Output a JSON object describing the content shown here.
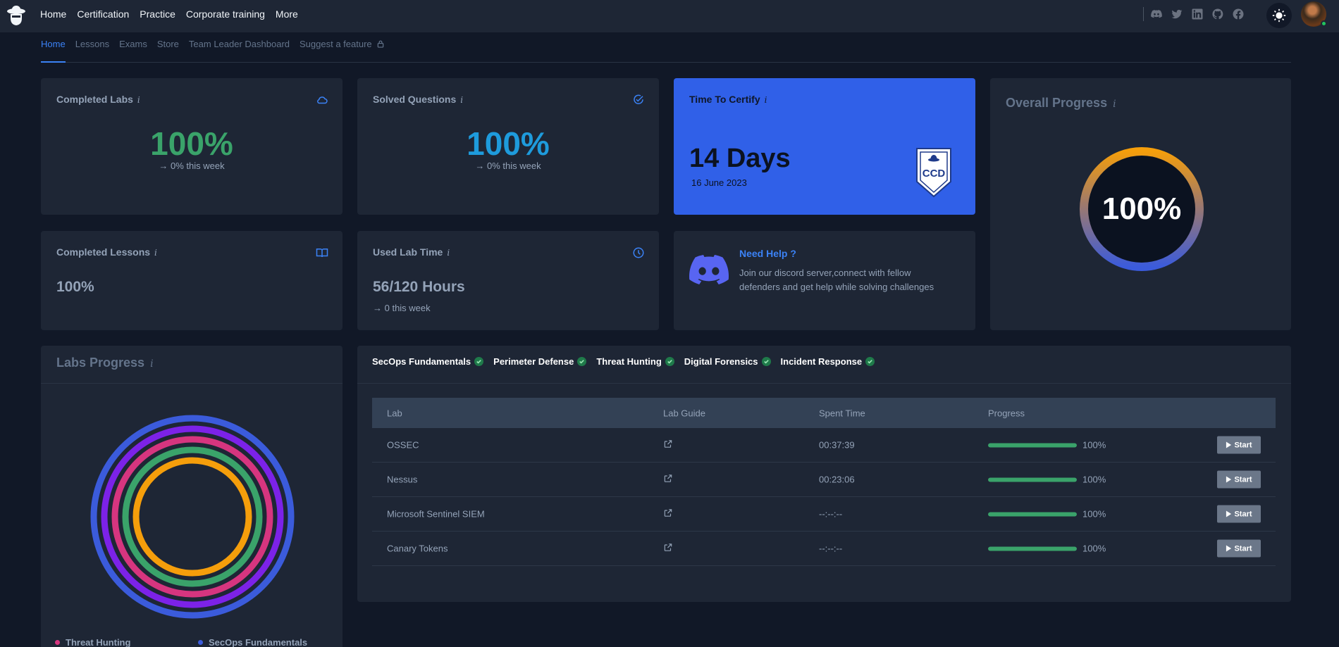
{
  "topnav": {
    "items": [
      "Home",
      "Certification",
      "Practice",
      "Corporate training",
      "More"
    ],
    "social_icons": [
      "discord-icon",
      "twitter-icon",
      "linkedin-icon",
      "github-icon",
      "facebook-icon"
    ]
  },
  "subtabs": [
    "Home",
    "Lessons",
    "Exams",
    "Store",
    "Team Leader Dashboard",
    "Suggest a feature"
  ],
  "cards": {
    "completed_labs": {
      "title": "Completed Labs",
      "value": "100%",
      "week": "→ 0% this week",
      "color": "#3aa36a"
    },
    "solved_questions": {
      "title": "Solved Questions",
      "value": "100%",
      "week": "→ 0% this week",
      "color": "#1e9bdc"
    },
    "time_to_certify": {
      "title": "Time To Certify",
      "days": "14 Days",
      "date": "16 June 2023",
      "badge_text": "CCD"
    },
    "overall_progress": {
      "title": "Overall Progress",
      "value": "100%",
      "progress": 1.0
    },
    "completed_lessons": {
      "title": "Completed Lessons",
      "value": "100%"
    },
    "used_lab_time": {
      "title": "Used Lab Time",
      "value": "56/120 Hours",
      "week": "→  0 this week"
    },
    "need_help": {
      "title": "Need Help ?",
      "text": "Join our discord server,connect with fellow defenders and get help while solving challenges"
    }
  },
  "labs_progress": {
    "title": "Labs Progress",
    "rings": [
      {
        "name": "SecOps Fundamentals",
        "color": "#3b5bdb",
        "progress": 1.0
      },
      {
        "name": "Perimeter Defense",
        "color": "#7c22e8",
        "progress": 1.0
      },
      {
        "name": "Threat Hunting",
        "color": "#d6357f",
        "progress": 1.0
      },
      {
        "name": "Digital Forensics",
        "color": "#3aa36a",
        "progress": 1.0
      },
      {
        "name": "Incident Response",
        "color": "#f59e0b",
        "progress": 1.0
      }
    ],
    "legend": [
      {
        "name": "Threat Hunting",
        "color": "#d6357f"
      },
      {
        "name": "SecOps Fundamentals",
        "color": "#3b5bdb"
      }
    ]
  },
  "lab_categories": [
    "SecOps Fundamentals",
    "Perimeter Defense",
    "Threat Hunting",
    "Digital Forensics",
    "Incident Response"
  ],
  "lab_table": {
    "headers": [
      "Lab",
      "Lab Guide",
      "Spent Time",
      "Progress"
    ],
    "rows": [
      {
        "lab": "OSSEC",
        "time": "00:37:39",
        "progress": "100%",
        "action": "Start"
      },
      {
        "lab": "Nessus",
        "time": "00:23:06",
        "progress": "100%",
        "action": "Start"
      },
      {
        "lab": "Microsoft Sentinel SIEM",
        "time": "--:--:--",
        "progress": "100%",
        "action": "Start"
      },
      {
        "lab": "Canary Tokens",
        "time": "--:--:--",
        "progress": "100%",
        "action": "Start"
      }
    ]
  }
}
